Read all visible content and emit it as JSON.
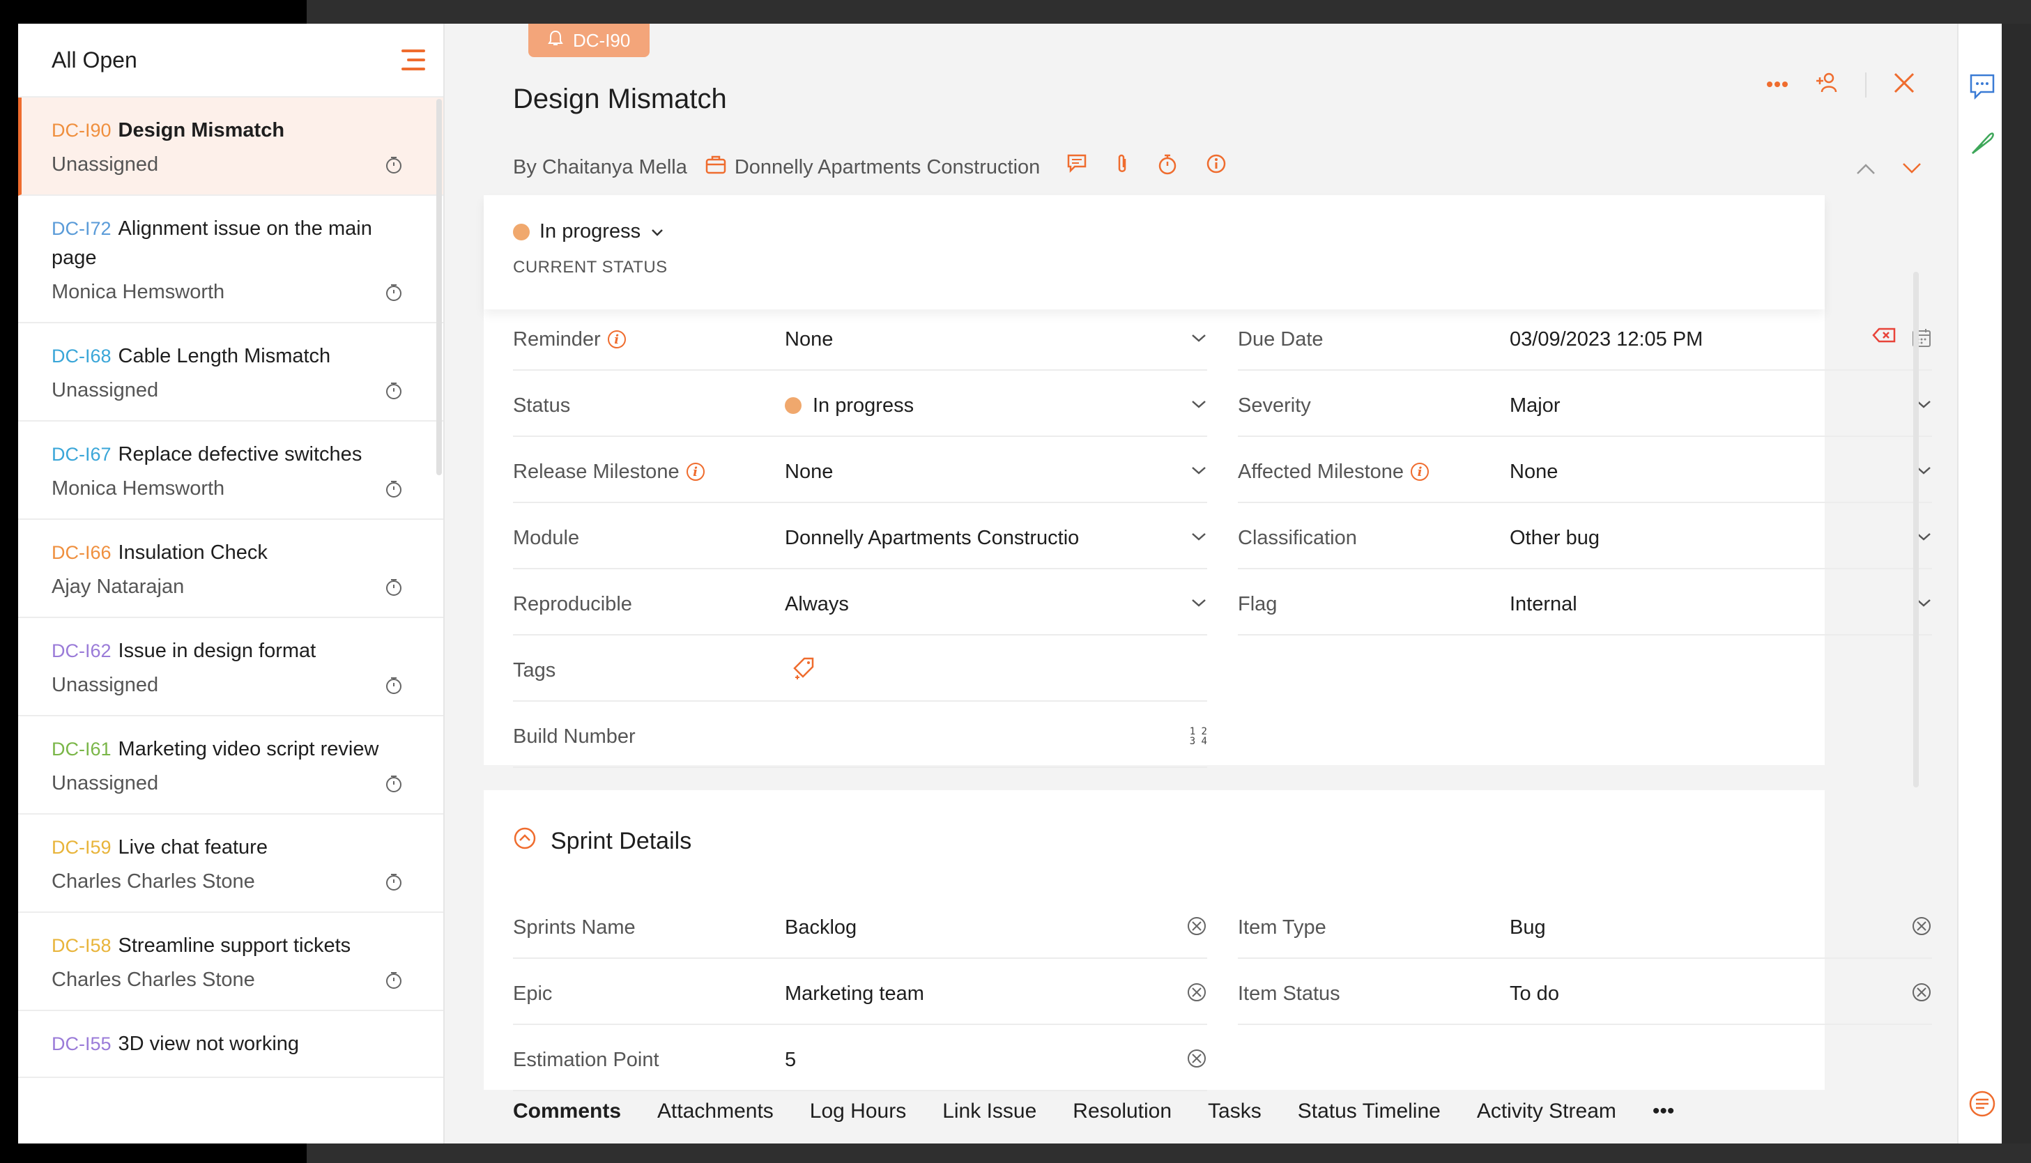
{
  "sidebar": {
    "title": "All Open",
    "items": [
      {
        "id": "DC-I90",
        "id_color": "#ef8f3e",
        "title": "Design Mismatch",
        "assignee": "Unassigned",
        "active": true
      },
      {
        "id": "DC-I72",
        "id_color": "#5a9bd8",
        "title": "Alignment issue on the main page",
        "assignee": "Monica Hemsworth"
      },
      {
        "id": "DC-I68",
        "id_color": "#3aa6d8",
        "title": "Cable Length Mismatch",
        "assignee": "Unassigned"
      },
      {
        "id": "DC-I67",
        "id_color": "#3aa6d8",
        "title": "Replace defective switches",
        "assignee": "Monica Hemsworth"
      },
      {
        "id": "DC-I66",
        "id_color": "#ef8f3e",
        "title": "Insulation Check",
        "assignee": "Ajay Natarajan"
      },
      {
        "id": "DC-I62",
        "id_color": "#9a7bd8",
        "title": "Issue in design format",
        "assignee": "Unassigned"
      },
      {
        "id": "DC-I61",
        "id_color": "#7ab648",
        "title": "Marketing video script review",
        "assignee": "Unassigned"
      },
      {
        "id": "DC-I59",
        "id_color": "#e8b43a",
        "title": "Live chat feature",
        "assignee": "Charles Charles Stone"
      },
      {
        "id": "DC-I58",
        "id_color": "#e8b43a",
        "title": "Streamline support tickets",
        "assignee": "Charles Charles Stone"
      },
      {
        "id": "DC-I55",
        "id_color": "#9a7bd8",
        "title": "3D view not working",
        "assignee": ""
      }
    ]
  },
  "detail": {
    "tag": "DC-I90",
    "title": "Design Mismatch",
    "author": "By Chaitanya Mella",
    "project": "Donnelly Apartments Construction",
    "status": "In progress",
    "status_caption": "CURRENT STATUS",
    "fields_left": [
      {
        "label": "Reminder",
        "value": "None",
        "info": true
      },
      {
        "label": "Status",
        "value": "In progress",
        "dot": true
      },
      {
        "label": "Release Milestone",
        "value": "None",
        "info": true
      },
      {
        "label": "Module",
        "value": "Donnelly Apartments Constructio"
      },
      {
        "label": "Reproducible",
        "value": "Always"
      },
      {
        "label": "Tags",
        "value": ""
      },
      {
        "label": "Build Number",
        "value": ""
      }
    ],
    "fields_right": [
      {
        "label": "Due Date",
        "value": "03/09/2023 12:05 PM"
      },
      {
        "label": "Severity",
        "value": "Major"
      },
      {
        "label": "Affected Milestone",
        "value": "None",
        "info": true
      },
      {
        "label": "Classification",
        "value": "Other bug"
      },
      {
        "label": "Flag",
        "value": "Internal"
      }
    ],
    "sprint": {
      "heading": "Sprint Details",
      "left": [
        {
          "label": "Sprints Name",
          "value": "Backlog"
        },
        {
          "label": "Epic",
          "value": "Marketing team"
        },
        {
          "label": "Estimation Point",
          "value": "5"
        }
      ],
      "right": [
        {
          "label": "Item Type",
          "value": "Bug"
        },
        {
          "label": "Item Status",
          "value": "To do"
        }
      ]
    },
    "tabs": [
      "Comments",
      "Attachments",
      "Log Hours",
      "Link Issue",
      "Resolution",
      "Tasks",
      "Status Timeline",
      "Activity Stream"
    ],
    "more_tabs": "•••",
    "build_number_icon": "1 2\n3 4"
  },
  "colors": {
    "accent": "#ef6c2e",
    "status_dot": "#f0a86d",
    "tag_bg": "#f3a57a"
  }
}
